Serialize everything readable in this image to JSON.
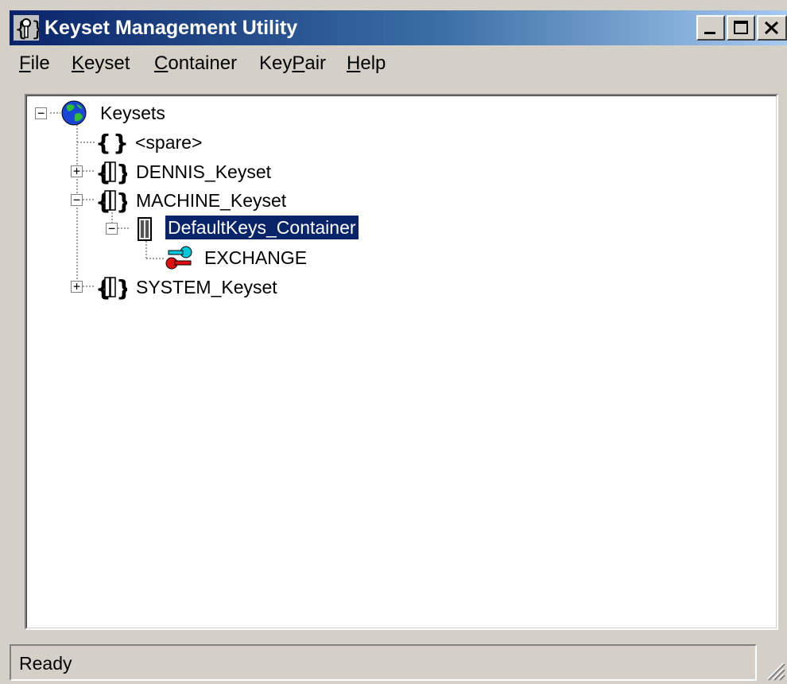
{
  "window": {
    "title": "Keyset Management Utility",
    "icon": "keyset-app-icon",
    "controls": [
      "minimize-icon",
      "maximize-icon",
      "close-icon"
    ]
  },
  "menu": {
    "file": {
      "hotkey": "F",
      "rest": "ile"
    },
    "keyset": {
      "hotkey": "K",
      "rest": "eyset"
    },
    "container": {
      "hotkey": "C",
      "rest": "ontainer"
    },
    "keypair": {
      "pre": "Key",
      "hotkey": "P",
      "rest": "air"
    },
    "help": {
      "hotkey": "H",
      "rest": "elp"
    }
  },
  "tree": {
    "root": {
      "label": "Keysets",
      "icon": "globe-icon",
      "expanded": true
    },
    "spare": {
      "label": "<spare>",
      "icon": "empty-keyset-icon"
    },
    "dennis": {
      "label": "DENNIS_Keyset",
      "icon": "keyset-icon",
      "expanded": false
    },
    "machine": {
      "label": "MACHINE_Keyset",
      "icon": "keyset-icon",
      "expanded": true
    },
    "container": {
      "label": "DefaultKeys_Container",
      "icon": "container-icon",
      "expanded": true,
      "selected": true
    },
    "exchange": {
      "label": "EXCHANGE",
      "icon": "key-pair-icon"
    },
    "system": {
      "label": "SYSTEM_Keyset",
      "icon": "keyset-icon",
      "expanded": false
    }
  },
  "status": {
    "text": "Ready"
  },
  "colors": {
    "titlebar_start": "#0a246a",
    "titlebar_end": "#a6caf0",
    "face": "#d4d0c8",
    "selection": "#0a246a"
  }
}
